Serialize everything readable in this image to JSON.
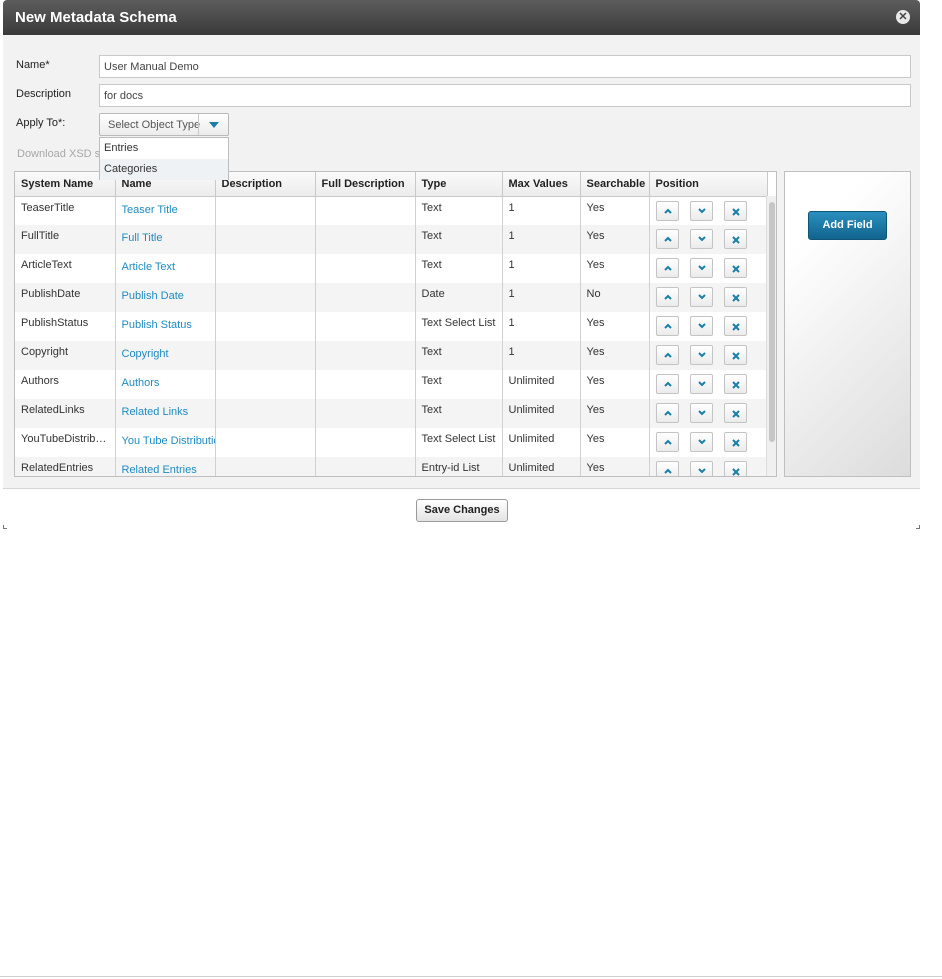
{
  "dialog": {
    "title": "New Metadata Schema",
    "close_icon": "close-icon"
  },
  "form": {
    "name_label": "Name*",
    "name_value": "User Manual Demo",
    "description_label": "Description",
    "description_value": "for docs",
    "apply_to_label": "Apply To*:",
    "apply_to_selected": "Select Object Type",
    "apply_to_options": [
      "Entries",
      "Categories"
    ],
    "download_link": "Download XSD sc"
  },
  "table": {
    "headers": [
      "System Name",
      "Name",
      "Description",
      "Full Description",
      "Type",
      "Max Values",
      "Searchable",
      "Position"
    ],
    "rows": [
      {
        "system_name": "TeaserTitle",
        "name": "Teaser Title",
        "description": "",
        "full_description": "",
        "type": "Text",
        "max_values": "1",
        "searchable": "Yes"
      },
      {
        "system_name": "FullTitle",
        "name": "Full Title",
        "description": "",
        "full_description": "",
        "type": "Text",
        "max_values": "1",
        "searchable": "Yes"
      },
      {
        "system_name": "ArticleText",
        "name": "Article Text",
        "description": "",
        "full_description": "",
        "type": "Text",
        "max_values": "1",
        "searchable": "Yes"
      },
      {
        "system_name": "PublishDate",
        "name": "Publish Date",
        "description": "",
        "full_description": "",
        "type": "Date",
        "max_values": "1",
        "searchable": "No"
      },
      {
        "system_name": "PublishStatus",
        "name": "Publish Status",
        "description": "",
        "full_description": "",
        "type": "Text Select List",
        "max_values": "1",
        "searchable": "Yes"
      },
      {
        "system_name": "Copyright",
        "name": "Copyright",
        "description": "",
        "full_description": "",
        "type": "Text",
        "max_values": "1",
        "searchable": "Yes"
      },
      {
        "system_name": "Authors",
        "name": "Authors",
        "description": "",
        "full_description": "",
        "type": "Text",
        "max_values": "Unlimited",
        "searchable": "Yes"
      },
      {
        "system_name": "RelatedLinks",
        "name": "Related Links",
        "description": "",
        "full_description": "",
        "type": "Text",
        "max_values": "Unlimited",
        "searchable": "Yes"
      },
      {
        "system_name": "YouTubeDistribut...",
        "name": "You Tube Distributio",
        "description": "",
        "full_description": "",
        "type": "Text Select List",
        "max_values": "Unlimited",
        "searchable": "Yes"
      },
      {
        "system_name": "RelatedEntries",
        "name": "Related Entries",
        "description": "",
        "full_description": "",
        "type": "Entry-id List",
        "max_values": "Unlimited",
        "searchable": "Yes"
      }
    ],
    "position_icons": [
      "chevron-up-icon",
      "chevron-down-icon",
      "delete-x-icon"
    ]
  },
  "side_panel": {
    "add_field_label": "Add Field"
  },
  "footer": {
    "save_label": "Save Changes"
  },
  "colors": {
    "title_bar": "#4a4a4a",
    "link": "#1e8bc3",
    "accent_button": "#1a7aa6"
  }
}
